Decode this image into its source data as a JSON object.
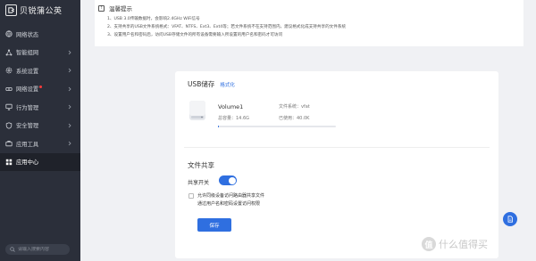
{
  "brand": {
    "name": "贝锐蒲公英"
  },
  "sidebar": {
    "items": [
      {
        "label": "网络状态",
        "icon": "globe-icon",
        "has_chevron": false,
        "active": false
      },
      {
        "label": "智能组网",
        "icon": "network-icon",
        "has_chevron": true,
        "active": false
      },
      {
        "label": "系统设置",
        "icon": "settings-icon",
        "has_chevron": true,
        "active": false
      },
      {
        "label": "网络设置",
        "icon": "link-icon",
        "has_chevron": true,
        "active": false,
        "dot": true
      },
      {
        "label": "行为管理",
        "icon": "monitor-icon",
        "has_chevron": true,
        "active": false
      },
      {
        "label": "安全管理",
        "icon": "shield-icon",
        "has_chevron": true,
        "active": false
      },
      {
        "label": "应用工具",
        "icon": "toolbox-icon",
        "has_chevron": true,
        "active": false
      },
      {
        "label": "应用中心",
        "icon": "apps-icon",
        "has_chevron": false,
        "active": true
      }
    ],
    "search_placeholder": "请输入搜索内容"
  },
  "tips": {
    "title": "温馨提示",
    "lines": [
      "1、USB 3.0传输数据时，会影响2.4GHz WiFi信号",
      "2、支持共享的USB文件系统格式：VFAT、NTFS、Ext3、Ext4等；若文件系统不在支持范围内，建议格式化成支持共享的文件系统",
      "3、设置用户名和密码后，访问USB存储文件的所有设备需要输入所设置的用户名和密码才可访问"
    ]
  },
  "storage": {
    "title": "USB储存",
    "format_label": "格式化",
    "volume": {
      "name": "Volume1",
      "total": "总容量：14.6G",
      "filesystem": "文件系统：vfat",
      "used": "已使用：40.0K",
      "usage_fraction": 0.003
    }
  },
  "share": {
    "title": "文件共享",
    "switch_label": "共享开关",
    "switch_on": true,
    "checkbox_lines": [
      "允许同级设备访问路由器共享文件",
      "通过用户名和密码设置访问权限"
    ],
    "save_label": "保存"
  },
  "watermark": {
    "logo": "值",
    "text": "什么值得买"
  },
  "colors": {
    "accent": "#2f6fe0",
    "sidebar_bg": "#2b2f3a",
    "dot": "#ff3b3b"
  }
}
